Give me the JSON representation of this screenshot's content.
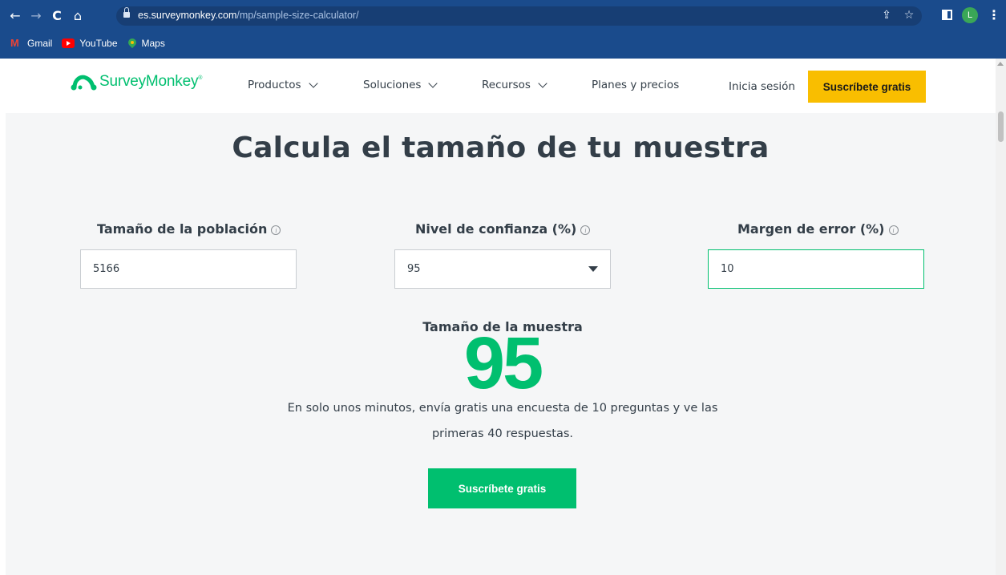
{
  "browser": {
    "url_host": "es.surveymonkey.com",
    "url_path": "/mp/sample-size-calculator/",
    "profile_initial": "L",
    "bookmarks": [
      {
        "label": "Gmail",
        "icon": "gmail-icon"
      },
      {
        "label": "YouTube",
        "icon": "youtube-icon"
      },
      {
        "label": "Maps",
        "icon": "maps-icon"
      }
    ]
  },
  "header": {
    "logo_text": "SurveyMonkey",
    "nav": [
      {
        "label": "Productos"
      },
      {
        "label": "Soluciones"
      },
      {
        "label": "Recursos"
      },
      {
        "label": "Planes y precios"
      }
    ],
    "login_label": "Inicia sesión",
    "cta_label": "Suscríbete gratis"
  },
  "main": {
    "title": "Calcula el tamaño de tu muestra",
    "fields": [
      {
        "label": "Tamaño de la población",
        "value": "5166"
      },
      {
        "label": "Nivel de confianza (%)",
        "value": "95"
      },
      {
        "label": "Margen de error (%)",
        "value": "10"
      }
    ],
    "result_label": "Tamaño de la muestra",
    "result_value": "95",
    "promo_line1": "En solo unos minutos, envía gratis una encuesta de 10 preguntas y ve las",
    "promo_line2": "primeras 40 respuestas.",
    "cta_label": "Suscríbete gratis"
  },
  "colors": {
    "brand_green": "#00bf6f",
    "cta_yellow": "#f9be00",
    "chrome_blue": "#1a4b8c"
  }
}
